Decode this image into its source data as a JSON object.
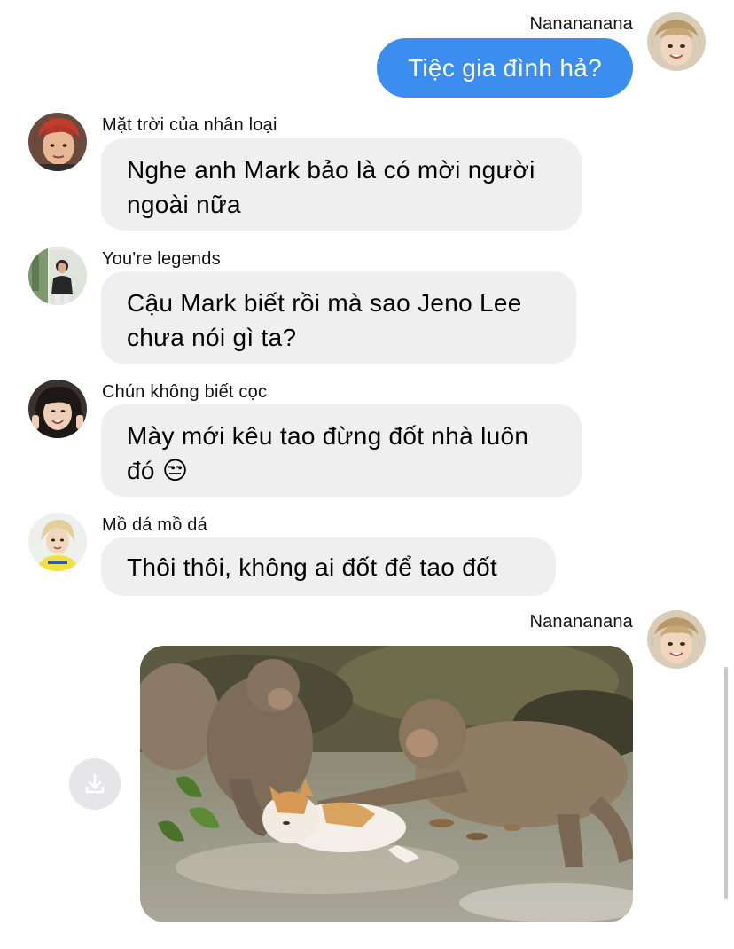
{
  "messages": [
    {
      "sender": "Nanananana",
      "text": "Tiệc gia đình hả?"
    },
    {
      "sender": "Mặt trời của nhân loại",
      "text": "Nghe anh Mark bảo là có mời người ngoài nữa",
      "line1": "Nghe anh Mark bảo là có mời người",
      "line2": "ngoài nữa"
    },
    {
      "sender": "You're legends",
      "line1": "Cậu Mark biết rồi mà sao Jeno Lee",
      "line2": "chưa nói gì ta?"
    },
    {
      "sender": "Chún không biết cọc",
      "line1": "Mày mới kêu tao đừng đốt nhà luôn",
      "line2": "đó",
      "emoji": "😒"
    },
    {
      "sender": "Mồ dá mồ dá",
      "text": "Thôi thôi, không ai đốt để tao đốt"
    },
    {
      "sender": "Nanananana",
      "attachment": "monkeys-and-cat-photo"
    }
  ],
  "icons": {
    "download": "download-icon"
  },
  "colors": {
    "outgoing_bubble": "#3b8df0",
    "incoming_bubble": "#efeff0"
  }
}
